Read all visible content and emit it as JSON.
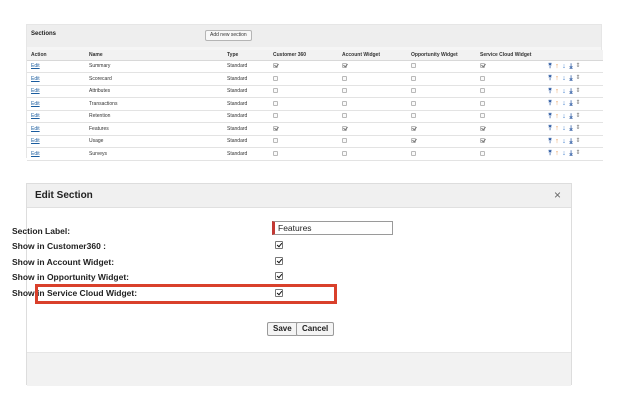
{
  "sections": {
    "title": "Sections",
    "add_button_label": "Add new section",
    "columns": [
      "Action",
      "Name",
      "Type",
      "Customer 360",
      "Account Widget",
      "Opportunity Widget",
      "Service Cloud Widget",
      ""
    ],
    "rows": [
      {
        "action": "Edit",
        "name": "Summary",
        "type": "Standard",
        "c360": true,
        "account": true,
        "opportunity": false,
        "service": true
      },
      {
        "action": "Edit",
        "name": "Scorecard",
        "type": "Standard",
        "c360": false,
        "account": false,
        "opportunity": false,
        "service": false
      },
      {
        "action": "Edit",
        "name": "Attributes",
        "type": "Standard",
        "c360": false,
        "account": false,
        "opportunity": false,
        "service": false
      },
      {
        "action": "Edit",
        "name": "Transactions",
        "type": "Standard",
        "c360": false,
        "account": false,
        "opportunity": false,
        "service": false
      },
      {
        "action": "Edit",
        "name": "Retention",
        "type": "Standard",
        "c360": false,
        "account": false,
        "opportunity": false,
        "service": false
      },
      {
        "action": "Edit",
        "name": "Features",
        "type": "Standard",
        "c360": true,
        "account": true,
        "opportunity": true,
        "service": true
      },
      {
        "action": "Edit",
        "name": "Usage",
        "type": "Standard",
        "c360": false,
        "account": false,
        "opportunity": true,
        "service": true
      },
      {
        "action": "Edit",
        "name": "Surveys",
        "type": "Standard",
        "c360": false,
        "account": false,
        "opportunity": false,
        "service": false
      }
    ],
    "reorder_icons": [
      "move-top-icon",
      "move-up-icon",
      "move-down-icon",
      "move-bottom-icon",
      "drag-reorder-icon"
    ]
  },
  "dialog": {
    "title": "Edit Section",
    "close_glyph": "×",
    "section_label": {
      "label": "Section Label:",
      "value": "Features"
    },
    "fields": [
      {
        "label": "Show in Customer360 :",
        "checked": true
      },
      {
        "label": "Show in Account Widget:",
        "checked": true
      },
      {
        "label": "Show in Opportunity Widget:",
        "checked": true
      },
      {
        "label": "Show in Service Cloud Widget:",
        "checked": true
      }
    ],
    "save_label": "Save",
    "cancel_label": "Cancel"
  },
  "colors": {
    "highlight": "#d9402b",
    "link": "#1a5c9e",
    "required_marker": "#c23934"
  }
}
